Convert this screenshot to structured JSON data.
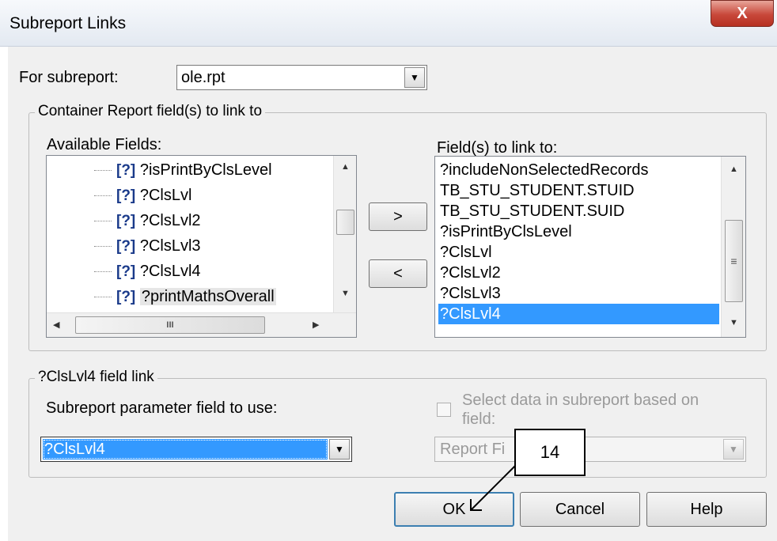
{
  "window": {
    "title": "Subreport Links",
    "close_glyph": "X"
  },
  "subreport": {
    "label": "For subreport:",
    "value": "ole.rpt"
  },
  "container_group": {
    "legend": "Container Report field(s) to link to",
    "available_label": "Available Fields:",
    "available_fields": [
      "?isPrintByClsLevel",
      "?ClsLvl",
      "?ClsLvl2",
      "?ClsLvl3",
      "?ClsLvl4",
      "?printMathsOverall"
    ],
    "add_button": ">",
    "remove_button": "<",
    "link_label": "Field(s) to link to:",
    "linked_fields": [
      "?includeNonSelectedRecords",
      "TB_STU_STUDENT.STUID",
      "TB_STU_STUDENT.SUID",
      "?isPrintByClsLevel",
      "?ClsLvl",
      "?ClsLvl2",
      "?ClsLvl3",
      "?ClsLvl4"
    ],
    "selected_linked_index": 7,
    "hscroll_mark": "III",
    "vscroll_mark": "≡"
  },
  "field_link_group": {
    "legend": "?ClsLvl4 field link",
    "param_label": "Subreport parameter field to use:",
    "param_value": "?ClsLvl4",
    "select_data_label": "Select data in subreport based on field:",
    "select_data_checked": false,
    "report_field_value": "Report Fi"
  },
  "buttons": {
    "ok": "OK",
    "cancel": "Cancel",
    "help": "Help"
  },
  "annotation": {
    "callout_number": "14"
  },
  "icons": {
    "tree_item": "[?]"
  },
  "colors": {
    "selection": "#3399ff",
    "close": "#c8483a"
  }
}
